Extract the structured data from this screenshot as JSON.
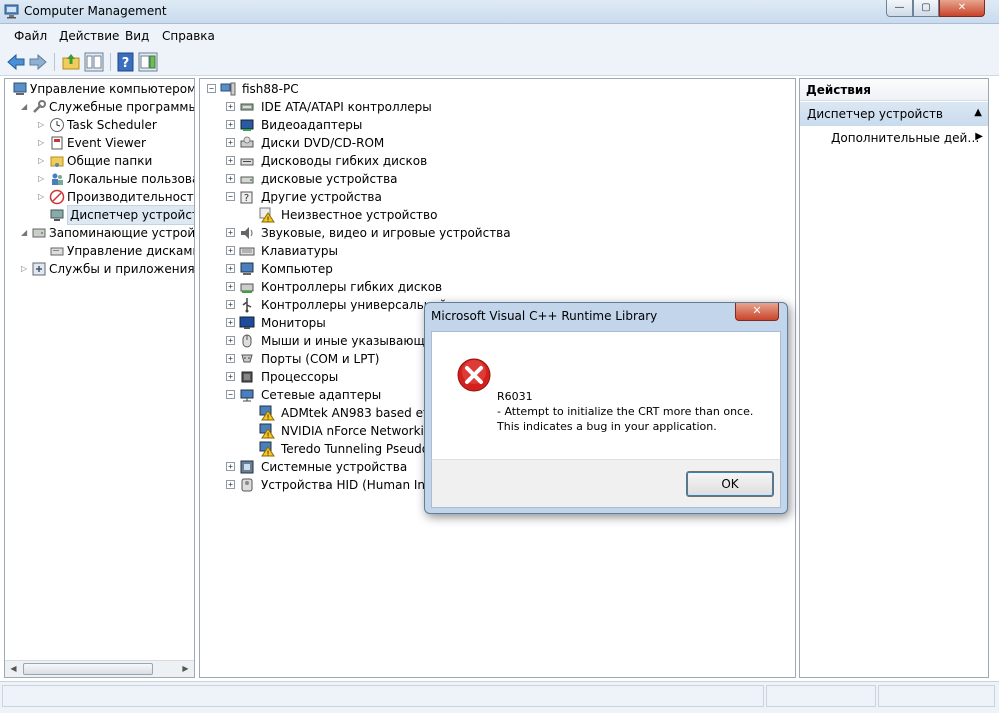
{
  "window": {
    "title": "Computer Management",
    "controls": {
      "minimize": "—",
      "maximize": "▢",
      "close": "✕"
    }
  },
  "menu": [
    "Файл",
    "Действие",
    "Вид",
    "Справка"
  ],
  "icons": [
    "back-arrow-icon",
    "forward-arrow-icon",
    "up-folder-icon",
    "show-hide-tree-icon",
    "help-icon",
    "action-pane-icon"
  ],
  "left_tree": [
    {
      "label": "Управление компьютером (л",
      "icon": "computer-mgmt-icon",
      "expander": ""
    },
    {
      "label": "Служебные программы",
      "icon": "tools-icon",
      "expander": "◢"
    },
    {
      "label": "Task Scheduler",
      "icon": "clock-icon",
      "expander": "▷"
    },
    {
      "label": "Event Viewer",
      "icon": "event-viewer-icon",
      "expander": "▷"
    },
    {
      "label": "Общие папки",
      "icon": "shared-folder-icon",
      "expander": "▷"
    },
    {
      "label": "Локальные пользовате",
      "icon": "users-icon",
      "expander": "▷"
    },
    {
      "label": "Производительность",
      "icon": "performance-icon",
      "expander": "▷"
    },
    {
      "label": "Диспетчер устройств",
      "icon": "device-manager-icon",
      "expander": "",
      "selected": true
    },
    {
      "label": "Запоминающие устройст",
      "icon": "storage-icon",
      "expander": "◢"
    },
    {
      "label": "Управление дисками",
      "icon": "disk-mgmt-icon",
      "expander": ""
    },
    {
      "label": "Службы и приложения",
      "icon": "services-icon",
      "expander": "▷"
    }
  ],
  "device_tree": {
    "root": "fish88-PC",
    "items": [
      {
        "label": "IDE ATA/ATAPI контроллеры",
        "expander": "+",
        "level": 1,
        "icon": "ide-icon"
      },
      {
        "label": "Видеоадаптеры",
        "expander": "+",
        "level": 1,
        "icon": "display-adapter-icon"
      },
      {
        "label": "Диски DVD/CD-ROM",
        "expander": "+",
        "level": 1,
        "icon": "dvd-icon"
      },
      {
        "label": "Дисководы гибких дисков",
        "expander": "+",
        "level": 1,
        "icon": "floppy-drive-icon"
      },
      {
        "label": "дисковые устройства",
        "expander": "+",
        "level": 1,
        "icon": "disk-drive-icon"
      },
      {
        "label": "Другие устройства",
        "expander": "−",
        "level": 1,
        "icon": "unknown-device-icon"
      },
      {
        "label": "Неизвестное устройство",
        "expander": "",
        "level": 2,
        "icon": "warning-device-icon"
      },
      {
        "label": "Звуковые, видео и игровые устройства",
        "expander": "+",
        "level": 1,
        "icon": "speaker-icon"
      },
      {
        "label": "Клавиатуры",
        "expander": "+",
        "level": 1,
        "icon": "keyboard-icon"
      },
      {
        "label": "Компьютер",
        "expander": "+",
        "level": 1,
        "icon": "computer-icon"
      },
      {
        "label": "Контроллеры гибких дисков",
        "expander": "+",
        "level": 1,
        "icon": "floppy-controller-icon"
      },
      {
        "label": "Контроллеры универсальной",
        "expander": "+",
        "level": 1,
        "icon": "usb-icon"
      },
      {
        "label": "Мониторы",
        "expander": "+",
        "level": 1,
        "icon": "monitor-icon"
      },
      {
        "label": "Мыши и иные указывающие",
        "expander": "+",
        "level": 1,
        "icon": "mouse-icon"
      },
      {
        "label": "Порты (COM и LPT)",
        "expander": "+",
        "level": 1,
        "icon": "port-icon"
      },
      {
        "label": "Процессоры",
        "expander": "+",
        "level": 1,
        "icon": "cpu-icon"
      },
      {
        "label": "Сетевые адаптеры",
        "expander": "−",
        "level": 1,
        "icon": "network-adapter-icon"
      },
      {
        "label": "ADMtek AN983 based ethe",
        "expander": "",
        "level": 2,
        "icon": "warning-network-icon"
      },
      {
        "label": "NVIDIA nForce Networking",
        "expander": "",
        "level": 2,
        "icon": "warning-network-icon"
      },
      {
        "label": "Teredo Tunneling Pseudo-I",
        "expander": "",
        "level": 2,
        "icon": "warning-network-icon"
      },
      {
        "label": "Системные устройства",
        "expander": "+",
        "level": 1,
        "icon": "system-device-icon"
      },
      {
        "label": "Устройства HID (Human Interf",
        "expander": "+",
        "level": 1,
        "icon": "hid-icon"
      }
    ]
  },
  "actions": {
    "header": "Действия",
    "section": "Диспетчер устройств",
    "section_arrow": "▲",
    "item": "Дополнительные дей…",
    "item_arrow": "▶"
  },
  "dialog": {
    "title": "Microsoft Visual C++ Runtime Library",
    "close": "✕",
    "code": "R6031",
    "line1": "- Attempt to initialize the CRT more than once.",
    "line2": "This indicates a bug in your application.",
    "ok": "OK",
    "icon": "error-icon"
  },
  "scroll": {
    "left": "◀",
    "right": "▶"
  },
  "colors": {
    "titlebar": "#c9dbee",
    "selection": "#dde8f3",
    "close": "#c8452b",
    "error": "#d4201c"
  }
}
